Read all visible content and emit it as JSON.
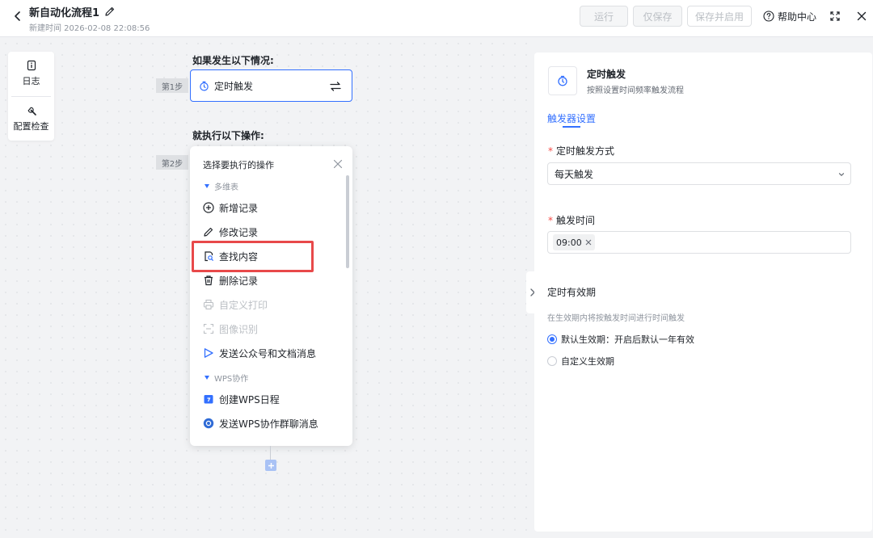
{
  "header": {
    "title": "新自动化流程1",
    "created": "新建时间 2026-02-08 22:08:56",
    "run_label": "运行",
    "save_label": "仅保存",
    "save_enable_label": "保存并启用",
    "help_label": "帮助中心"
  },
  "toolpanel": {
    "log_label": "日志",
    "check_label": "配置检查"
  },
  "flow": {
    "if_label": "如果发生以下情况:",
    "then_label": "就执行以下操作:",
    "step1": "第1步",
    "step2": "第2步",
    "trigger_label": "定时触发"
  },
  "action_menu": {
    "title": "选择要执行的操作",
    "groups": [
      {
        "name": "多维表",
        "items": [
          {
            "label": "新增记录",
            "icon": "plus-circle-icon",
            "enabled": true
          },
          {
            "label": "修改记录",
            "icon": "pencil-icon",
            "enabled": true
          },
          {
            "label": "查找内容",
            "icon": "search-doc-icon",
            "enabled": true,
            "highlighted": true
          },
          {
            "label": "删除记录",
            "icon": "trash-icon",
            "enabled": true
          },
          {
            "label": "自定义打印",
            "icon": "printer-icon",
            "enabled": false
          },
          {
            "label": "图像识别",
            "icon": "scan-icon",
            "enabled": false
          },
          {
            "label": "发送公众号和文档消息",
            "icon": "send-icon",
            "enabled": true
          }
        ]
      },
      {
        "name": "WPS协作",
        "items": [
          {
            "label": "创建WPS日程",
            "icon": "calendar-icon",
            "enabled": true
          },
          {
            "label": "发送WPS协作群聊消息",
            "icon": "chat-icon",
            "enabled": true
          }
        ]
      }
    ]
  },
  "right_panel": {
    "title": "定时触发",
    "description": "按照设置时间频率触发流程",
    "tab": "触发器设置",
    "trigger_mode_label": "定时触发方式",
    "trigger_mode_value": "每天触发",
    "trigger_time_label": "触发时间",
    "trigger_time_value": "09:00",
    "validity_title": "定时有效期",
    "validity_desc": "在生效期内将按触发时间进行时间触发",
    "option_default": "默认生效期：开启后默认一年有效",
    "option_custom": "自定义生效期"
  },
  "colors": {
    "accent": "#3370ff",
    "highlight_border": "#e8494a",
    "required": "#f54a45"
  }
}
